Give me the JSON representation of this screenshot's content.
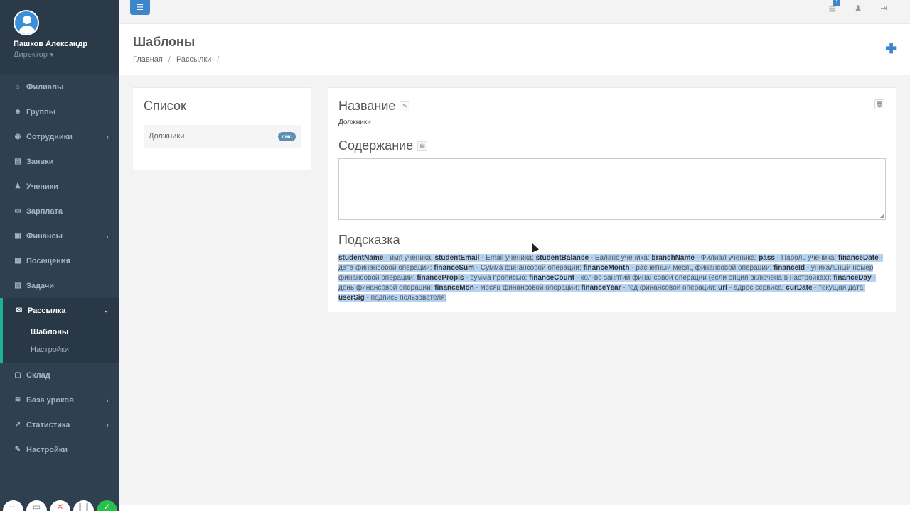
{
  "user": {
    "name": "Пашков Александр",
    "role": "Директор"
  },
  "sidebar": {
    "items": [
      {
        "label": "Филиалы",
        "icon": "bank-icon",
        "glyph": "⌂",
        "arrow": ""
      },
      {
        "label": "Группы",
        "icon": "users-icon",
        "glyph": "☻",
        "arrow": ""
      },
      {
        "label": "Сотрудники",
        "icon": "user-circle-icon",
        "glyph": "◉",
        "arrow": "‹"
      },
      {
        "label": "Заявки",
        "icon": "book-icon",
        "glyph": "▤",
        "arrow": ""
      },
      {
        "label": "Ученики",
        "icon": "user-icon",
        "glyph": "♟",
        "arrow": ""
      },
      {
        "label": "Зарплата",
        "icon": "credit-card-icon",
        "glyph": "▭",
        "arrow": ""
      },
      {
        "label": "Финансы",
        "icon": "money-icon",
        "glyph": "▣",
        "arrow": "‹"
      },
      {
        "label": "Посещения",
        "icon": "calendar-icon",
        "glyph": "▦",
        "arrow": ""
      },
      {
        "label": "Задачи",
        "icon": "tasks-icon",
        "glyph": "▥",
        "arrow": ""
      }
    ],
    "active": {
      "label": "Рассылка",
      "icon": "envelope-icon",
      "glyph": "✉",
      "arrow": "⌄",
      "sub": [
        {
          "label": "Шаблоны"
        },
        {
          "label": "Настройки"
        }
      ]
    },
    "items_after": [
      {
        "label": "Склад",
        "icon": "box-icon",
        "glyph": "▢",
        "arrow": ""
      },
      {
        "label": "База уроков",
        "icon": "database-icon",
        "glyph": "≋",
        "arrow": "‹"
      },
      {
        "label": "Статистика",
        "icon": "chart-icon",
        "glyph": "↗",
        "arrow": "‹"
      },
      {
        "label": "Настройки",
        "icon": "wrench-icon",
        "glyph": "✎",
        "arrow": ""
      }
    ]
  },
  "topbar": {
    "notifications_count": "1"
  },
  "page": {
    "title": "Шаблоны",
    "breadcrumb": [
      "Главная",
      "Рассылки"
    ],
    "add_glyph": "✚"
  },
  "list_panel": {
    "title": "Список",
    "items": [
      {
        "label": "Должники",
        "tag": "смс"
      }
    ]
  },
  "editor": {
    "name_title": "Название",
    "name_value": "Должники",
    "content_title": "Содержание",
    "content_value": "",
    "hint_title": "Подсказка",
    "hint_parts": [
      [
        "studentName",
        " - имя ученика; "
      ],
      [
        "studentEmail",
        " - Email ученика; "
      ],
      [
        "studentBalance",
        " - Баланс ученика; "
      ],
      [
        "branchName",
        " - Филиал ученика; "
      ],
      [
        "pass",
        " - Пароль ученика; "
      ],
      [
        "financeDate",
        " - дата финансовой операции; "
      ],
      [
        "financeSum",
        " - Сумма финансовой операции; "
      ],
      [
        "financeMonth",
        " - расчетный месяц финансовой операции; "
      ],
      [
        "financeId",
        " - уникальный номер финансовой операции; "
      ],
      [
        "financePropis",
        " - сумма прописью; "
      ],
      [
        "financeCount",
        " - кол-во занятий финансовой операции (если опция включена в настройках); "
      ],
      [
        "financeDay",
        " - день финансовой операции; "
      ],
      [
        "financeMon",
        " - месяц финансовой операции; "
      ],
      [
        "financeYear",
        " - год финансовой операции; "
      ],
      [
        "url",
        " - адрес сервиса; "
      ],
      [
        "curDate",
        " - текущая дата; "
      ],
      [
        "userSig",
        " - подпись пользователя;"
      ]
    ]
  }
}
